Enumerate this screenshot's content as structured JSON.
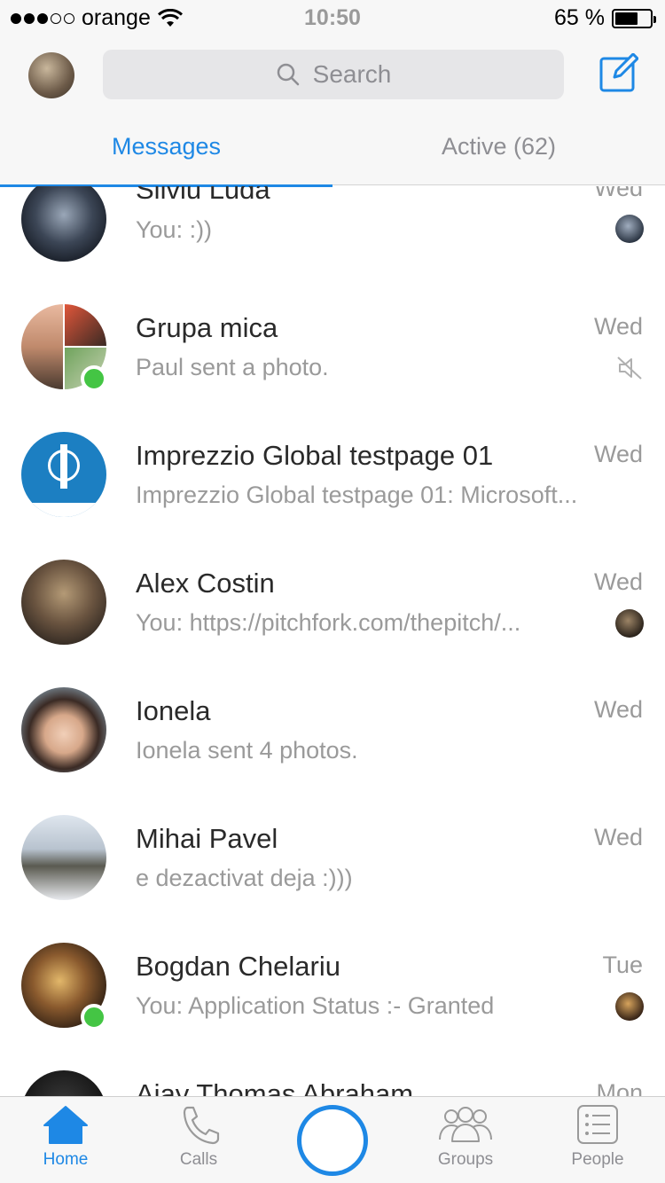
{
  "status_bar": {
    "carrier": "orange",
    "time": "10:50",
    "battery_percent": "65 %",
    "battery_level": 0.65,
    "signal_bars_filled": 3
  },
  "header": {
    "search_placeholder": "Search",
    "tabs": [
      {
        "label": "Messages",
        "selected": true
      },
      {
        "label": "Active (62)",
        "selected": false
      }
    ]
  },
  "conversations": [
    {
      "name": "Silviu Luda",
      "preview": "You: :))",
      "time": "Wed",
      "indicator": "seen-avatar",
      "online": false
    },
    {
      "name": "Grupa mica",
      "preview": "Paul sent a photo.",
      "time": "Wed",
      "indicator": "muted-icon",
      "online": true
    },
    {
      "name": "Imprezzio Global testpage 01",
      "preview": "Imprezzio Global testpage 01: Microsoft...",
      "time": "Wed",
      "indicator": "none",
      "online": false
    },
    {
      "name": "Alex Costin",
      "preview": "You: https://pitchfork.com/thepitch/...",
      "time": "Wed",
      "indicator": "seen-avatar",
      "online": false
    },
    {
      "name": "Ionela",
      "preview": "Ionela sent 4 photos.",
      "time": "Wed",
      "indicator": "none",
      "online": false
    },
    {
      "name": "Mihai Pavel",
      "preview": "e dezactivat deja :)))",
      "time": "Wed",
      "indicator": "none",
      "online": false
    },
    {
      "name": "Bogdan Chelariu",
      "preview": "You: Application Status :- Granted",
      "time": "Tue",
      "indicator": "seen-avatar",
      "online": true
    },
    {
      "name": "Ajay Thomas Abraham",
      "preview": "",
      "time": "Mon",
      "indicator": "none",
      "online": false
    }
  ],
  "tabbar": {
    "items": [
      {
        "label": "Home",
        "icon": "home-icon",
        "selected": true
      },
      {
        "label": "Calls",
        "icon": "phone-icon",
        "selected": false
      },
      {
        "label": "",
        "icon": "camera-capture-icon",
        "selected": false
      },
      {
        "label": "Groups",
        "icon": "groups-icon",
        "selected": false
      },
      {
        "label": "People",
        "icon": "people-list-icon",
        "selected": false
      }
    ]
  },
  "colors": {
    "accent": "#1e88e5",
    "online": "#44c544",
    "secondary_text": "#9a9a9a"
  }
}
